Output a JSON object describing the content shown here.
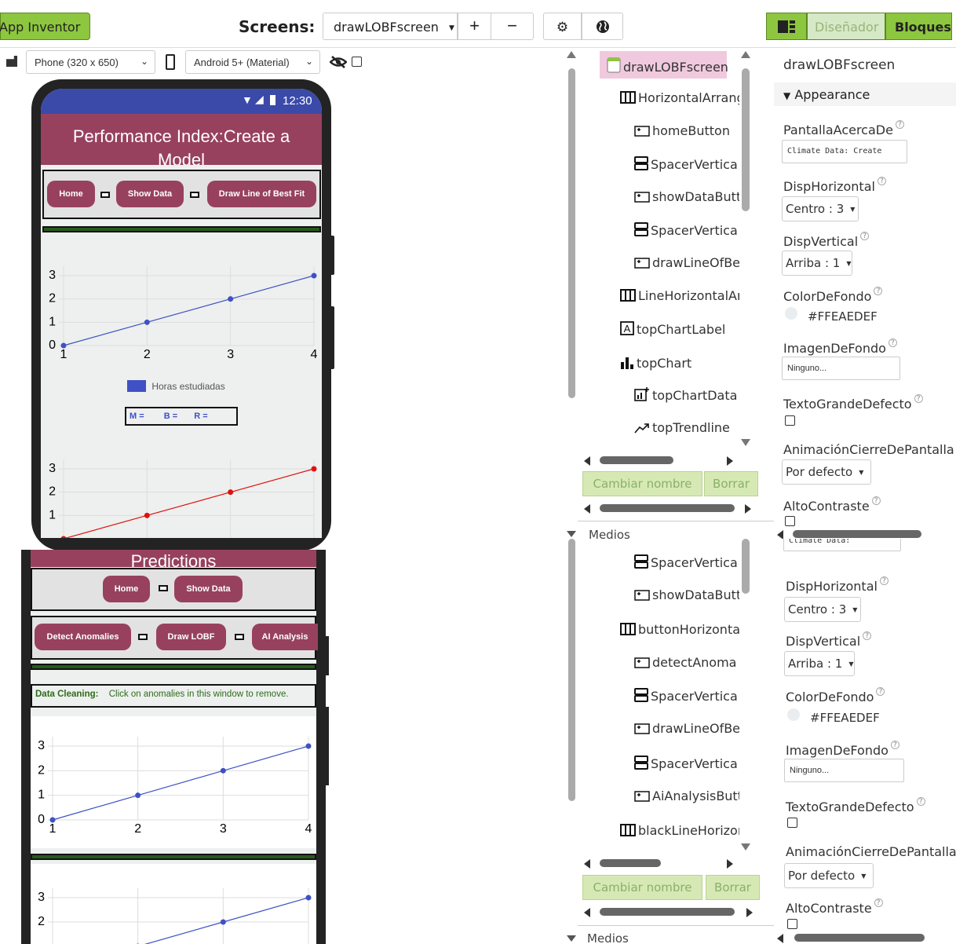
{
  "toolbar": {
    "app_label": "App Inventor",
    "screens_label": "Screens:",
    "screen_selected": "drawLOBFscreen",
    "add_screen": "+",
    "remove_screen": "−",
    "designer_label": "Diseñador",
    "blocks_label": "Bloques"
  },
  "viewer": {
    "phone_size": "Phone (320 x 650)",
    "theme": "Android 5+ (Material)",
    "status_time": "12:30",
    "app_title_top": "Performance Index:Create a Model",
    "app_title_bottom": "Predictions",
    "top_buttons": [
      "Home",
      "Show Data",
      "Draw Line of Best Fit"
    ],
    "bottom_buttons_row1": [
      "Home",
      "Show Data"
    ],
    "bottom_buttons_row2": [
      "Detect Anomalies",
      "Draw LOBF",
      "AI Analysis"
    ],
    "legend_label": "Horas estudiadas",
    "stats": {
      "m": "M =",
      "b": "B =",
      "r": "R ="
    },
    "data_cleaning_label": "Data Cleaning:",
    "data_cleaning_hint": "Click on anomalies in this window to remove."
  },
  "chart_data": [
    {
      "type": "line",
      "x": [
        1,
        2,
        3,
        4
      ],
      "values": [
        0,
        1,
        2,
        3
      ],
      "xticks": [
        "1",
        "2",
        "3",
        "4"
      ],
      "yticks": [
        "0",
        "1",
        "2",
        "3"
      ],
      "color": "#3f51c4",
      "legend": "Horas estudiadas"
    },
    {
      "type": "line",
      "x": [
        1,
        2,
        3,
        4
      ],
      "values": [
        0,
        1,
        2,
        3
      ],
      "yticks": [
        "1",
        "2",
        "3"
      ],
      "color": "#e01010"
    },
    {
      "type": "line",
      "x": [
        1,
        2,
        3,
        4
      ],
      "values": [
        0,
        1,
        2,
        3
      ],
      "xticks": [
        "1",
        "2",
        "3",
        "4"
      ],
      "yticks": [
        "0",
        "1",
        "2",
        "3"
      ],
      "color": "#3f51c4"
    },
    {
      "type": "line",
      "x": [
        1,
        2,
        3,
        4
      ],
      "values": [
        0,
        1,
        2,
        3
      ],
      "yticks": [
        "2",
        "3"
      ],
      "color": "#3f51c4"
    }
  ],
  "components_top": [
    {
      "name": "drawLOBFscreen",
      "icon": "screen-icon"
    },
    {
      "name": "HorizontalArrang",
      "icon": "horizontal-arrangement-icon"
    },
    {
      "name": "homeButton",
      "icon": "button-icon"
    },
    {
      "name": "SpacerVertica",
      "icon": "vertical-arrangement-icon"
    },
    {
      "name": "showDataButt",
      "icon": "button-icon"
    },
    {
      "name": "SpacerVertica",
      "icon": "vertical-arrangement-icon"
    },
    {
      "name": "drawLineOfBe:",
      "icon": "button-icon"
    },
    {
      "name": "LineHorizontalAr",
      "icon": "horizontal-arrangement-icon"
    },
    {
      "name": "topChartLabel",
      "icon": "label-icon"
    },
    {
      "name": "topChart",
      "icon": "chart-icon"
    },
    {
      "name": "topChartData",
      "icon": "chart-data-icon"
    },
    {
      "name": "topTrendline",
      "icon": "trendline-icon"
    }
  ],
  "components_bottom": [
    {
      "name": "SpacerVertica",
      "icon": "vertical-arrangement-icon"
    },
    {
      "name": "showDataButt",
      "icon": "button-icon"
    },
    {
      "name": "buttonHorizontal",
      "icon": "horizontal-arrangement-icon"
    },
    {
      "name": "detectAnoma",
      "icon": "button-icon"
    },
    {
      "name": "SpacerVertica",
      "icon": "vertical-arrangement-icon"
    },
    {
      "name": "drawLineOfBe:",
      "icon": "button-icon"
    },
    {
      "name": "SpacerVertica",
      "icon": "vertical-arrangement-icon"
    },
    {
      "name": "AiAnalysisButt",
      "icon": "button-icon"
    },
    {
      "name": "blackLineHorizor",
      "icon": "horizontal-arrangement-icon"
    }
  ],
  "component_actions": {
    "rename": "Cambiar nombre",
    "delete": "Borrar",
    "media": "Medios"
  },
  "properties": {
    "component": "drawLOBFscreen",
    "section": "Appearance",
    "about_label": "PantallaAcercaDe",
    "about_value": "Climate Data: Create",
    "about_value_short": "Climate Data:",
    "halign_label": "DispHorizontal",
    "halign_value": "Centro : 3",
    "valign_label": "DispVertical",
    "valign_value": "Arriba : 1",
    "bgcolor_label": "ColorDeFondo",
    "bgcolor_value": "#FFEAEDEF",
    "bgimage_label": "ImagenDeFondo",
    "bgimage_value": "Ninguno...",
    "bigtext_label": "TextoGrandeDefecto",
    "closeanim_label": "AnimaciónCierreDePantalla",
    "closeanim_value": "Por defecto",
    "contrast_label": "AltoContraste"
  }
}
